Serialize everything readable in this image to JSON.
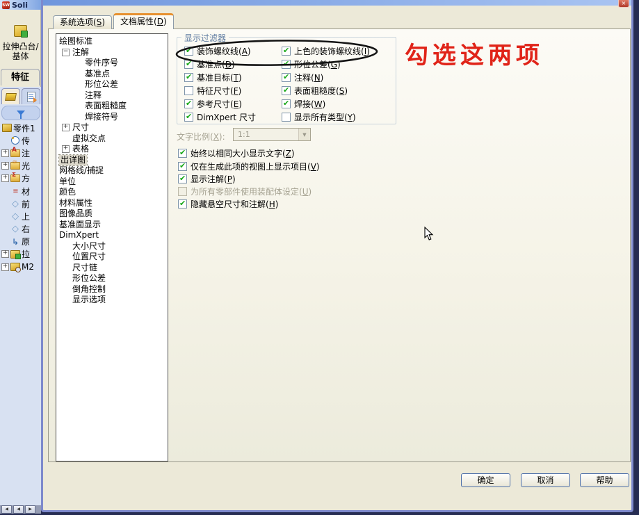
{
  "colors": {
    "accent_orange": "#e7902e",
    "check_green": "#17a817",
    "annotation_red": "#e02318",
    "titlebar_blue": "#7ba2e4",
    "dialog_border": "#7d89cc"
  },
  "app": {
    "logo": "SW",
    "title": "Soli",
    "toolbar_button": "拉伸凸台/基体",
    "toolbar_tab": "特征",
    "feature_tree": [
      {
        "label": "零件1",
        "icon": "part-icon",
        "level": 0,
        "expander": false
      },
      {
        "label": "传",
        "icon": "sensors-icon",
        "level": 1,
        "expander": false
      },
      {
        "label": "注",
        "icon": "annotations-folder-icon",
        "level": 1,
        "expander": true
      },
      {
        "label": "光",
        "icon": "lights-folder-icon",
        "level": 1,
        "expander": true
      },
      {
        "label": "方",
        "icon": "equations-folder-icon",
        "level": 1,
        "expander": true
      },
      {
        "label": "材",
        "icon": "material-icon",
        "level": 1,
        "expander": false
      },
      {
        "label": "前",
        "icon": "plane-icon",
        "level": 1,
        "expander": false
      },
      {
        "label": "上",
        "icon": "plane-icon",
        "level": 1,
        "expander": false
      },
      {
        "label": "右",
        "icon": "plane-icon",
        "level": 1,
        "expander": false
      },
      {
        "label": "原",
        "icon": "origin-icon",
        "level": 1,
        "expander": false
      },
      {
        "label": "拉",
        "icon": "extrude-icon",
        "level": 1,
        "expander": true
      },
      {
        "label": "M2",
        "icon": "thread-icon",
        "level": 1,
        "expander": true
      }
    ],
    "nav_buttons": [
      "◀",
      "◀",
      "▶"
    ]
  },
  "dialog": {
    "tabs": [
      {
        "label": "系统选项(S)",
        "active": false
      },
      {
        "label": "文档属性(D)",
        "active": true
      }
    ],
    "tree": {
      "items": [
        {
          "label": "绘图标准",
          "level": 0,
          "expander": null,
          "selected": false
        },
        {
          "label": "注解",
          "level": 1,
          "expander": "minus",
          "selected": false
        },
        {
          "label": "零件序号",
          "level": 2,
          "expander": null,
          "selected": false
        },
        {
          "label": "基准点",
          "level": 2,
          "expander": null,
          "selected": false
        },
        {
          "label": "形位公差",
          "level": 2,
          "expander": null,
          "selected": false
        },
        {
          "label": "注释",
          "level": 2,
          "expander": null,
          "selected": false
        },
        {
          "label": "表面粗糙度",
          "level": 2,
          "expander": null,
          "selected": false
        },
        {
          "label": "焊接符号",
          "level": 2,
          "expander": null,
          "selected": false
        },
        {
          "label": "尺寸",
          "level": 1,
          "expander": "plus",
          "selected": false
        },
        {
          "label": "虚拟交点",
          "level": 1,
          "expander": null,
          "selected": false
        },
        {
          "label": "表格",
          "level": 1,
          "expander": "plus",
          "selected": false
        },
        {
          "label": "出详图",
          "level": 0,
          "expander": null,
          "selected": true
        },
        {
          "label": "网格线/捕捉",
          "level": 0,
          "expander": null,
          "selected": false
        },
        {
          "label": "单位",
          "level": 0,
          "expander": null,
          "selected": false
        },
        {
          "label": "颜色",
          "level": 0,
          "expander": null,
          "selected": false
        },
        {
          "label": "材料属性",
          "level": 0,
          "expander": null,
          "selected": false
        },
        {
          "label": "图像品质",
          "level": 0,
          "expander": null,
          "selected": false
        },
        {
          "label": "基准面显示",
          "level": 0,
          "expander": null,
          "selected": false
        },
        {
          "label": "DimXpert",
          "level": 0,
          "expander": null,
          "selected": false
        },
        {
          "label": "大小尺寸",
          "level": 1,
          "expander": null,
          "selected": false
        },
        {
          "label": "位置尺寸",
          "level": 1,
          "expander": null,
          "selected": false
        },
        {
          "label": "尺寸链",
          "level": 1,
          "expander": null,
          "selected": false
        },
        {
          "label": "形位公差",
          "level": 1,
          "expander": null,
          "selected": false
        },
        {
          "label": "倒角控制",
          "level": 1,
          "expander": null,
          "selected": false
        },
        {
          "label": "显示选项",
          "level": 1,
          "expander": null,
          "selected": false
        }
      ]
    },
    "filter_group": {
      "title": "显示过滤器",
      "columns": [
        [
          {
            "label": "装饰螺纹线(A)",
            "checked": true
          },
          {
            "label": "基准点(D)",
            "checked": true
          },
          {
            "label": "基准目标(T)",
            "checked": true
          },
          {
            "label": "特征尺寸(F)",
            "checked": false
          },
          {
            "label": "参考尺寸(E)",
            "checked": true
          },
          {
            "label": "DimXpert 尺寸",
            "checked": true
          }
        ],
        [
          {
            "label": "上色的装饰螺纹线(I)",
            "checked": true
          },
          {
            "label": "形位公差(G)",
            "checked": true
          },
          {
            "label": "注释(N)",
            "checked": true
          },
          {
            "label": "表面粗糙度(S)",
            "checked": true
          },
          {
            "label": "焊接(W)",
            "checked": true
          },
          {
            "label": "显示所有类型(Y)",
            "checked": false
          }
        ]
      ]
    },
    "text_scale": {
      "label": "文字比例(X):",
      "value": "1:1",
      "disabled": true
    },
    "options": [
      {
        "label": "始终以相同大小显示文字(Z)",
        "checked": true,
        "disabled": false
      },
      {
        "label": "仅在生成此项的视图上显示项目(V)",
        "checked": true,
        "disabled": false
      },
      {
        "label": "显示注解(P)",
        "checked": true,
        "disabled": false
      },
      {
        "label": "为所有零部件使用装配体设定(U)",
        "checked": false,
        "disabled": true
      },
      {
        "label": "隐藏悬空尺寸和注解(H)",
        "checked": true,
        "disabled": false
      }
    ],
    "buttons": [
      "确定",
      "取消",
      "帮助"
    ]
  },
  "annotation": {
    "text": "勾选这两项"
  }
}
